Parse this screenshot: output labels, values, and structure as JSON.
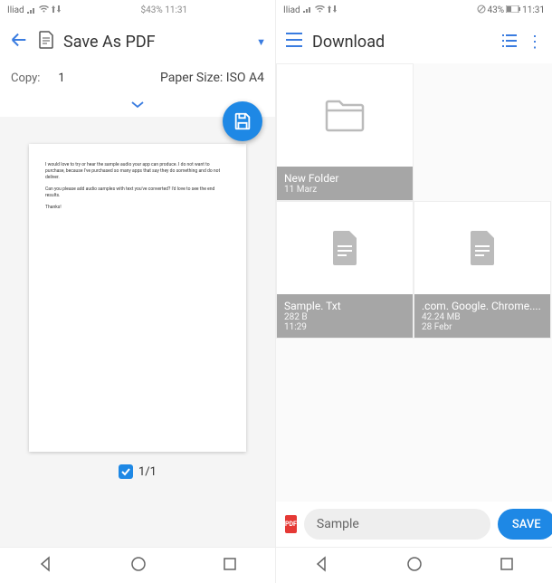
{
  "left": {
    "status": {
      "carrier": "Iliad",
      "battery": "43%",
      "time": "11:31",
      "center": "$43% 11:31"
    },
    "appbar": {
      "title": "Save As PDF"
    },
    "options": {
      "copy_label": "Copy:",
      "copy_value": "1",
      "paper_label": "Paper Size: ISO A4"
    },
    "preview": {
      "line1": "I would love to try or hear the sample audio your app can produce. I do not want to purchase, because I've purchased so many apps that say they do something and do not deliver.",
      "line2": "Can you please add audio samples with text you've converted? I'd love to see the end results.",
      "line3": "Thanks!"
    },
    "page_indicator": "1/1"
  },
  "right": {
    "status": {
      "carrier": "Iliad",
      "battery": "43%",
      "time": "11:31"
    },
    "appbar": {
      "title": "Download"
    },
    "files": [
      {
        "name": "New Folder",
        "meta1": "11 Marz",
        "meta2": "",
        "type": "folder"
      },
      {
        "name": "Sample. Txt",
        "meta1": "282 B",
        "meta2": "11:29",
        "type": "file"
      },
      {
        "name": ".com. Google. Chrome....",
        "meta1": "42.24 MB",
        "meta2": "28 Febr",
        "type": "file"
      }
    ],
    "save": {
      "pdf_badge": "PDF",
      "filename": "Sample",
      "button": "SAVE"
    }
  }
}
